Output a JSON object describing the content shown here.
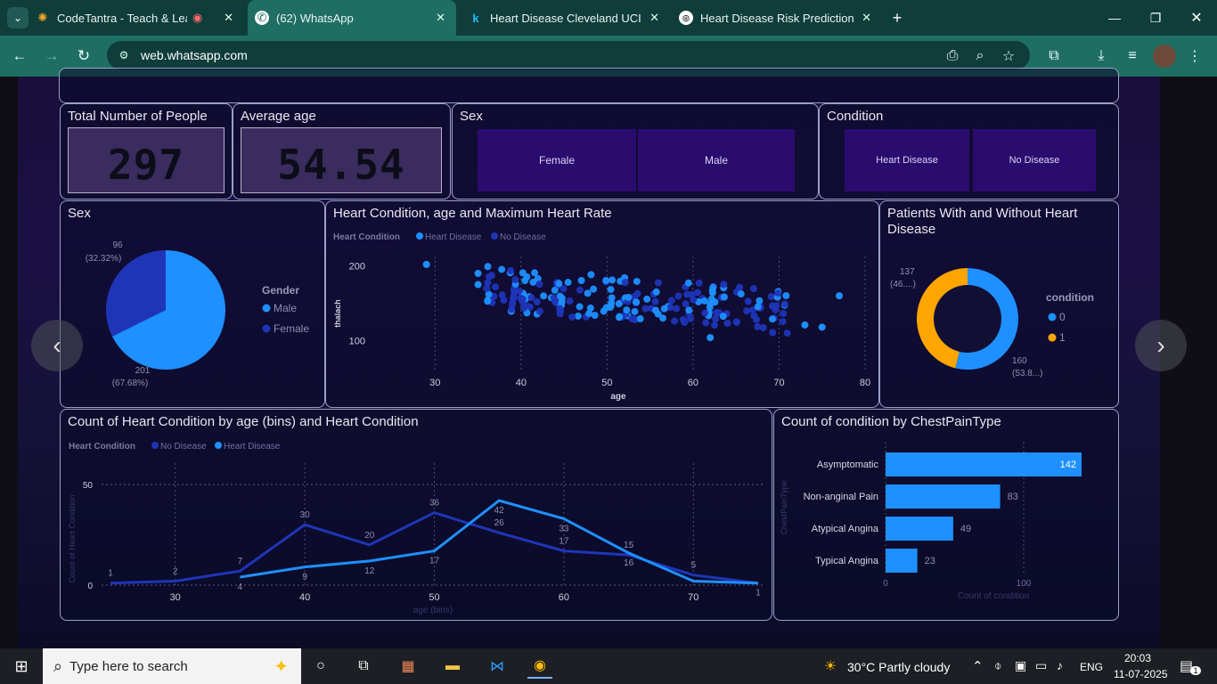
{
  "browser": {
    "tabs": [
      {
        "title": "CodeTantra - Teach & Learn",
        "icon": "gear-favicon-icon"
      },
      {
        "title": "(62) WhatsApp",
        "icon": "whatsapp-icon"
      },
      {
        "title": "Heart Disease Cleveland UCI",
        "icon": "kaggle-icon"
      },
      {
        "title": "Heart Disease Risk Prediction",
        "icon": "chatgpt-icon"
      }
    ],
    "url": "web.whatsapp.com"
  },
  "report": {
    "kpi_people": {
      "title": "Total Number of People",
      "value": "297"
    },
    "kpi_age": {
      "title": "Average age",
      "value": "54.54"
    },
    "sex_slicer": {
      "title": "Sex",
      "options": [
        "Female",
        "Male"
      ]
    },
    "condition_slicer": {
      "title": "Condition",
      "options": [
        "Heart Disease",
        "No Disease"
      ]
    },
    "colors": {
      "primary": "#1e90ff",
      "secondary": "#1f35b8",
      "orange": "#ffa500",
      "background": "#1a0f3a"
    }
  },
  "chart_data": [
    {
      "type": "pie",
      "title": "Sex",
      "legend_title": "Gender",
      "legend_placement": "right",
      "slices": [
        {
          "label": "Male",
          "value": 201,
          "pct": "(67.68%)",
          "color": "#1e90ff"
        },
        {
          "label": "Female",
          "value": 96,
          "pct": "(32.32%)",
          "color": "#1f35b8"
        }
      ]
    },
    {
      "type": "scatter",
      "title": "Heart Condition, age and Maximum Heart Rate",
      "legend_title": "Heart Condition",
      "series_names": [
        "Heart Disease",
        "No Disease"
      ],
      "xlabel": "age",
      "ylabel": "thalach",
      "xticks": [
        "30",
        "40",
        "50",
        "60",
        "70",
        "80"
      ],
      "yticks": [
        "100",
        "200"
      ],
      "xlim": [
        28,
        80
      ],
      "ylim": [
        60,
        215
      ]
    },
    {
      "type": "pie",
      "title": "Patients With and Without Heart Disease",
      "legend_title": "condition",
      "legend_placement": "right",
      "slices": [
        {
          "label": "0",
          "value": 160,
          "pct": "(53.8...)",
          "color": "#1e90ff"
        },
        {
          "label": "1",
          "value": 137,
          "pct": "(46....)",
          "color": "#ffa500"
        }
      ]
    },
    {
      "type": "line",
      "title": "Count of Heart Condition by age (bins) and Heart Condition",
      "legend_title": "Heart Condition",
      "xlabel": "age (bins)",
      "ylabel": "Count of Heart Condition",
      "xticks": [
        "30",
        "40",
        "50",
        "60",
        "70"
      ],
      "yticks": [
        "0",
        "50"
      ],
      "ylim": [
        0,
        50
      ],
      "x": [
        25,
        30,
        35,
        40,
        45,
        50,
        55,
        60,
        65,
        70,
        75
      ],
      "series": [
        {
          "name": "No Disease",
          "color": "#1f35b8",
          "values": [
            1,
            2,
            7,
            30,
            20,
            36,
            26,
            17,
            15,
            5,
            1
          ],
          "labels": [
            "1",
            "2",
            "7",
            "30",
            "20",
            "36",
            "26",
            "17",
            "15",
            "5",
            ""
          ]
        },
        {
          "name": "Heart Disease",
          "color": "#1e90ff",
          "values": [
            null,
            null,
            4,
            9,
            12,
            17,
            42,
            33,
            16,
            2,
            1
          ],
          "labels": [
            "",
            "",
            "4",
            "9",
            "12",
            "17",
            "42",
            "33",
            "16",
            "",
            "1"
          ]
        }
      ]
    },
    {
      "type": "bar",
      "title": "Count of condition by ChestPainType",
      "orientation": "horizontal",
      "xlabel": "Count of condition",
      "ylabel": "ChestPainType",
      "categories": [
        "Asymptomatic",
        "Non-anginal Pain",
        "Atypical Angina",
        "Typical Angina"
      ],
      "values": [
        142,
        83,
        49,
        23
      ],
      "xticks": [
        "0",
        "100"
      ],
      "xlim": [
        0,
        142
      ]
    }
  ],
  "taskbar": {
    "search_placeholder": "Type here to search",
    "weather": "30°C  Partly cloudy",
    "language": "ENG",
    "time": "20:03",
    "date": "11-07-2025",
    "notification_count": "1"
  }
}
